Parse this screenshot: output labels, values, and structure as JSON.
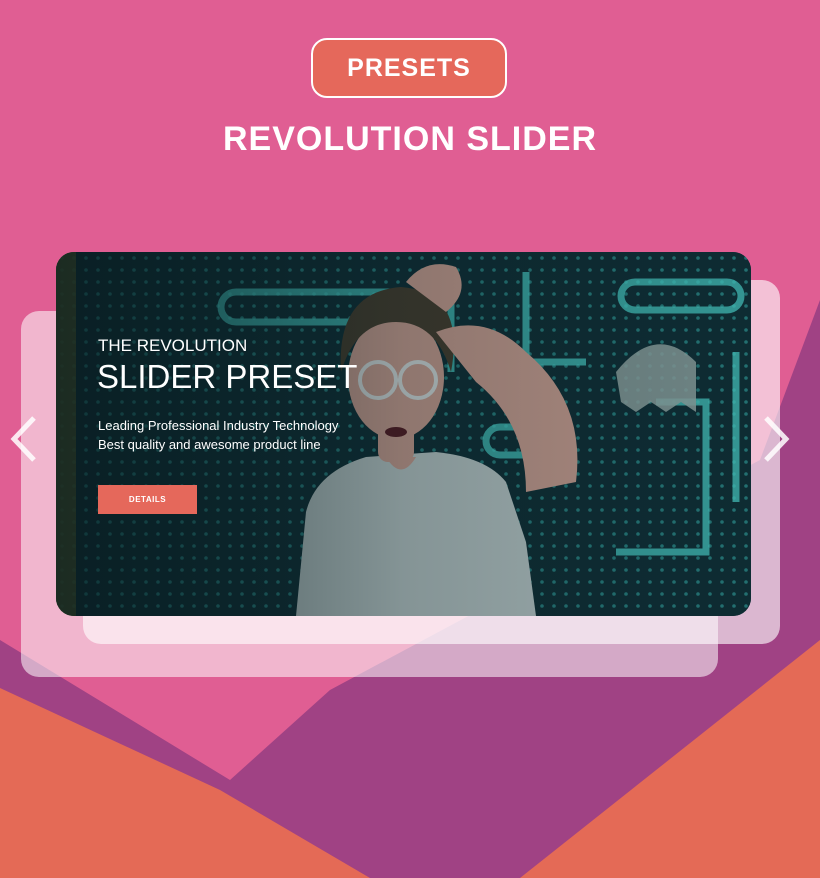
{
  "badge": {
    "label": "PRESETS"
  },
  "headline": "REVOLUTION SLIDER",
  "slide": {
    "eyebrow": "THE REVOLUTION",
    "title": "SLIDER PRESET",
    "description_line1": "Leading Professional Industry Technology",
    "description_line2": "Best quality and awesome product line",
    "button_label": "DETAILS"
  },
  "nav": {
    "prev_icon": "chevron-left-icon",
    "next_icon": "chevron-right-icon"
  },
  "colors": {
    "background": "#e05e93",
    "accent": "#e5685b",
    "purple": "#a04284",
    "coral": "#e46a56"
  }
}
